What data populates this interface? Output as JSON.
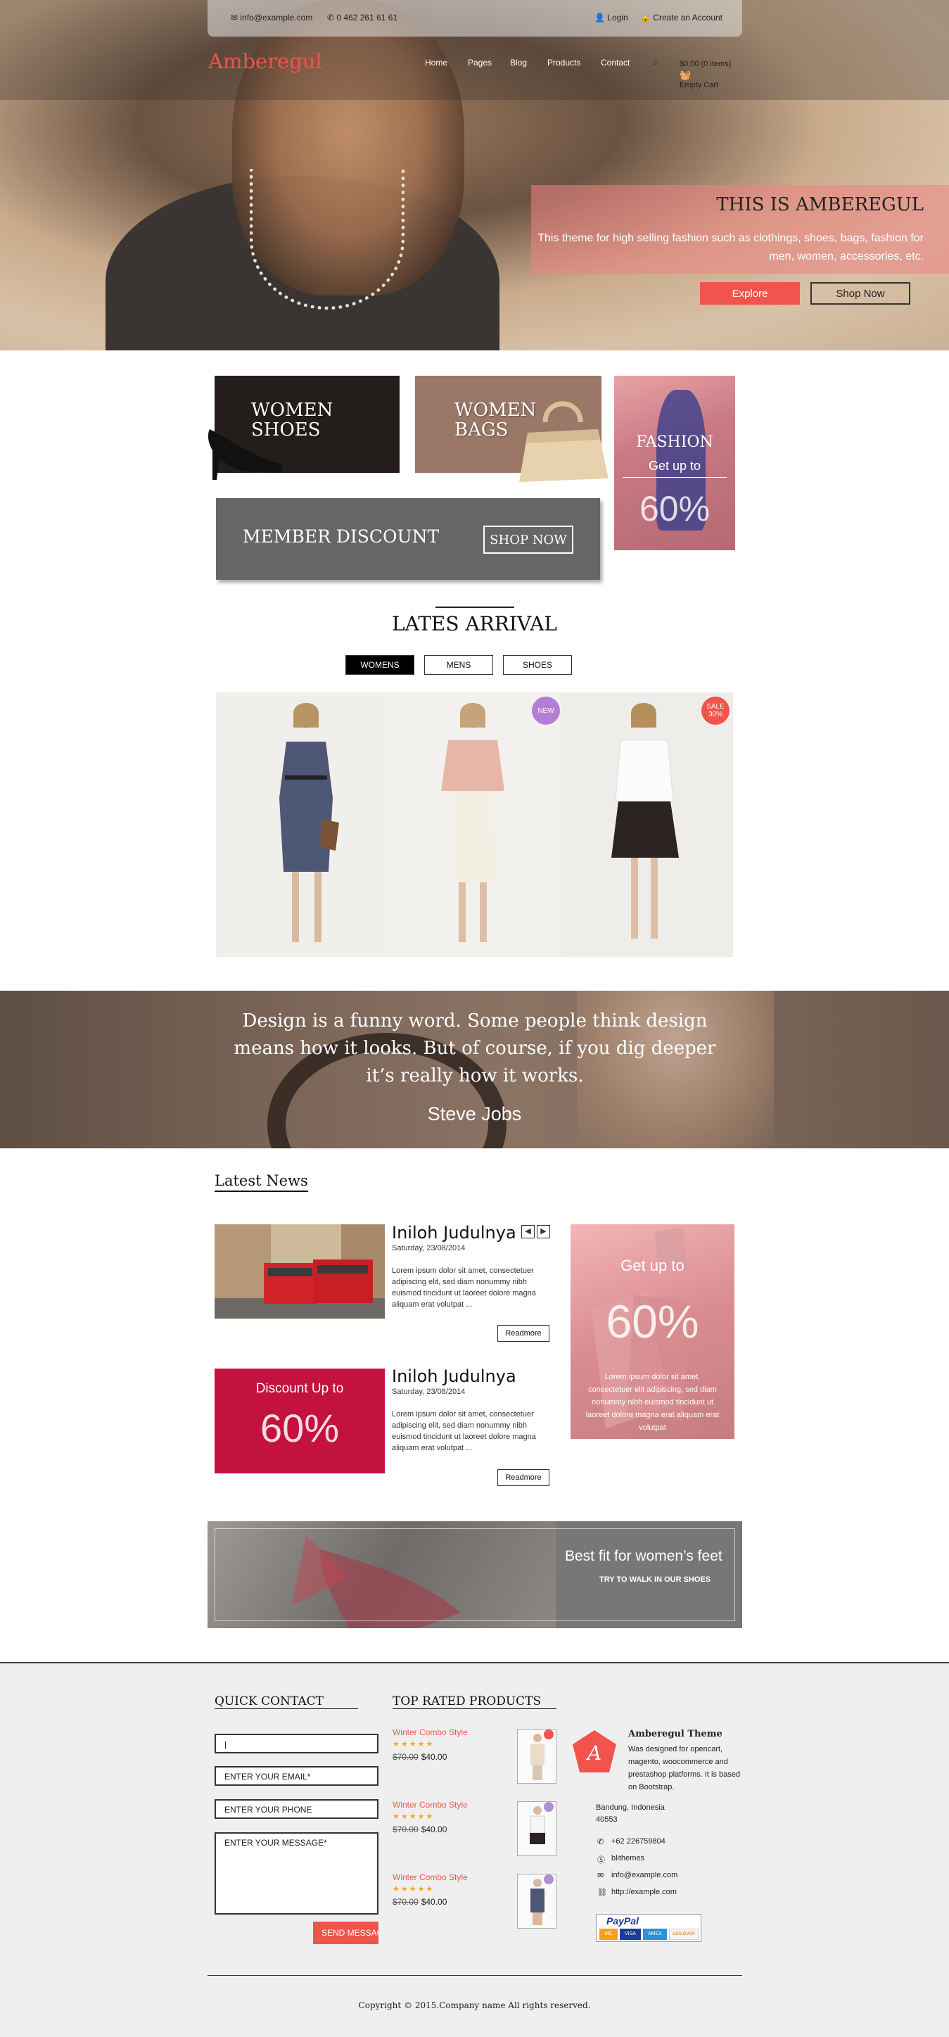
{
  "utility": {
    "email": "info@example.com",
    "phone": "0 462 261 61 61",
    "login": "Login",
    "create_account": "Create an Account"
  },
  "brand": {
    "logo": "Amberegul",
    "accent": "#f0544c"
  },
  "nav": {
    "home": "Home",
    "pages": "Pages",
    "blog": "Blog",
    "products": "Products",
    "contact": "Contact"
  },
  "cart": {
    "total": "$0.00 (0 items)",
    "status": "Empty Cart"
  },
  "hero": {
    "title": "THIS IS AMBEREGUL",
    "text": "This theme for high selling fashion such as clothings, shoes, bags, fashion for men, women, accessories, etc.",
    "explore": "Explore",
    "shop_now": "Shop Now"
  },
  "promos": {
    "women_shoes": "WOMEN SHOES",
    "women_bags": "WOMEN BAGS",
    "fashion": "FASHION",
    "fashion_sub": "Get up to",
    "fashion_pct": "60%",
    "member": "MEMBER DISCOUNT",
    "member_btn": "SHOP NOW"
  },
  "arrival": {
    "title": "LATES ARRIVAL",
    "tabs": [
      "WOMENS",
      "MENS",
      "SHOES"
    ],
    "badges": {
      "new": "NEW",
      "sale": "SALE 30%"
    }
  },
  "quote": {
    "text": "Design is a funny word. Some people think design means how it looks. But of course, if you dig deeper it’s really how it works.",
    "author": "Steve Jobs"
  },
  "news": {
    "title": "Latest News",
    "items": [
      {
        "title": "Iniloh Judulnya",
        "date": "Saturday, 23/08/2014",
        "body": "Lorem ipsum dolor sit amet, consectetuer adipiscing elit, sed diam nonummy nibh euismod tincidunt ut laoreet dolore magna aliquam erat volutpat ...",
        "readmore": "Readmore"
      },
      {
        "title": "Iniloh Judulnya",
        "date": "Saturday, 23/08/2014",
        "body": "Lorem ipsum dolor sit amet, consectetuer adipiscing elit, sed diam nonummy nibh euismod tincidunt ut laoreet dolore magna aliquam erat volutpat ...",
        "readmore": "Readmore"
      }
    ],
    "discount_label": "Discount Up to",
    "discount_pct": "60%",
    "side_label": "Get up to",
    "side_pct": "60%",
    "side_body": "Lorem ipsum dolor sit amet, consectetuer elit adipiscing, sed diam nonummy nibh euismod tincidunt ut laoreet dolore magna erat aliquam erat volutpat"
  },
  "banner": {
    "title": "Best fit for women’s feet",
    "sub": "TRY TO WALK IN OUR SHOES"
  },
  "footer": {
    "quick_contact": "QUICK CONTACT",
    "email_ph": "ENTER YOUR EMAIL*",
    "phone_ph": "ENTER YOUR PHONE",
    "message_ph": "ENTER YOUR MESSAGE*",
    "send": "SEND MESSAGE",
    "top_rated": "TOP RATED PRODUCTS",
    "products": [
      {
        "name": "Winter Combo Style",
        "stars": "★★★★★",
        "old": "$70.00",
        "new": "$40.00",
        "dot": "#f0544c"
      },
      {
        "name": "Winter Combo Style",
        "stars": "★★★★★",
        "old": "$70.00",
        "new": "$40.00",
        "dot": "#b18fd8"
      },
      {
        "name": "Winter Combo Style",
        "stars": "★★★★★",
        "old": "$70.00",
        "new": "$40.00",
        "dot": "#b18fd8"
      }
    ],
    "theme_name": "Amberegul Theme",
    "theme_desc": "Was designed for opencart, magento, woocommerce and prestashop platforms. It is based on Bootstrap.",
    "address1": "Bandung, Indonesia",
    "address2": "40553",
    "phone": "+62 226759804",
    "skype": "blithemes",
    "email": "info@example.com",
    "web": "http://example.com",
    "paypal": "PayPal",
    "cards": [
      "MC",
      "VISA",
      "AMEX",
      "DISCOVER"
    ],
    "copyright": "Copyright © 2015.Company name All rights reserved."
  }
}
